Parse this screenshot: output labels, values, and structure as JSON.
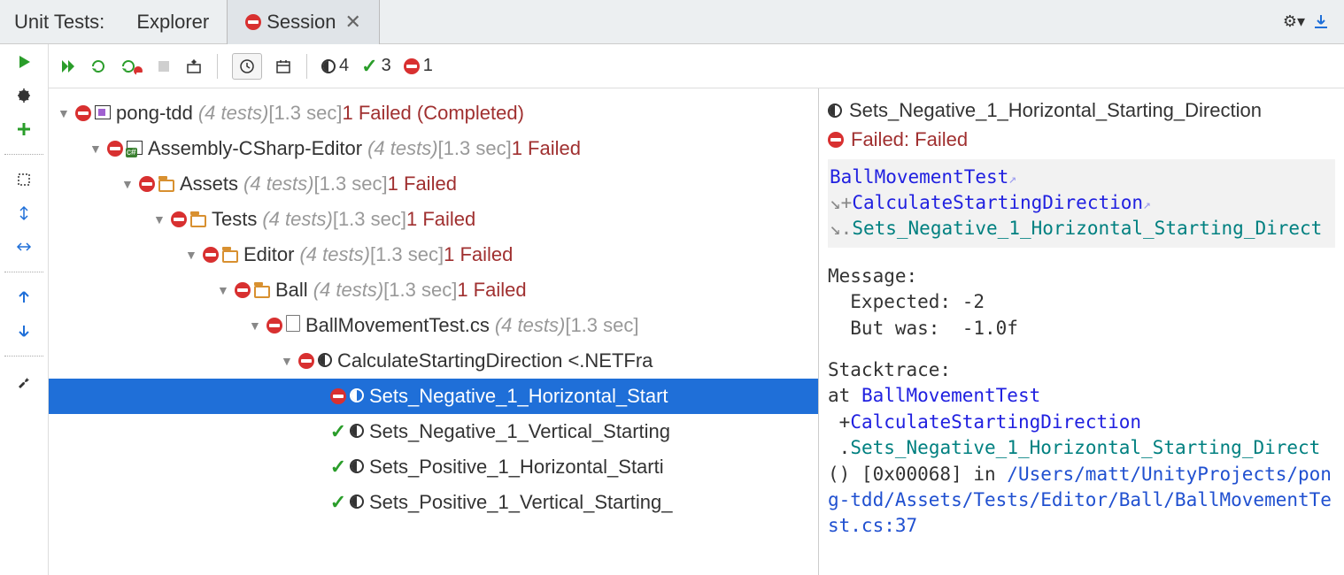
{
  "header": {
    "title": "Unit Tests:",
    "tabs": [
      {
        "label": "Explorer",
        "active": false,
        "closeable": false,
        "status": null
      },
      {
        "label": "Session",
        "active": true,
        "closeable": true,
        "status": "fail"
      }
    ]
  },
  "toolbar": {
    "counts": {
      "half": "4",
      "pass": "3",
      "fail": "1"
    }
  },
  "tree": {
    "rows": [
      {
        "depth": 0,
        "arrow": true,
        "status": "fail",
        "type": "proj",
        "name": "pong-tdd",
        "meta": "(4 tests)",
        "time": "[1.3 sec]",
        "fail": "1 Failed (Completed)"
      },
      {
        "depth": 1,
        "arrow": true,
        "status": "fail",
        "type": "cs",
        "name": "Assembly-CSharp-Editor",
        "meta": "(4 tests)",
        "time": "[1.3 sec]",
        "fail": "1 Failed"
      },
      {
        "depth": 2,
        "arrow": true,
        "status": "fail",
        "type": "folder",
        "name": "Assets",
        "meta": "(4 tests)",
        "time": "[1.3 sec]",
        "fail": "1 Failed"
      },
      {
        "depth": 3,
        "arrow": true,
        "status": "fail",
        "type": "folder",
        "name": "Tests",
        "meta": "(4 tests)",
        "time": "[1.3 sec]",
        "fail": "1 Failed"
      },
      {
        "depth": 4,
        "arrow": true,
        "status": "fail",
        "type": "folder",
        "name": "Editor",
        "meta": "(4 tests)",
        "time": "[1.3 sec]",
        "fail": "1 Failed"
      },
      {
        "depth": 5,
        "arrow": true,
        "status": "fail",
        "type": "folder",
        "name": "Ball",
        "meta": "(4 tests)",
        "time": "[1.3 sec]",
        "fail": "1 Failed"
      },
      {
        "depth": 6,
        "arrow": true,
        "status": "fail",
        "type": "file",
        "name": "BallMovementTest.cs",
        "meta": "(4 tests)",
        "time": "[1.3 sec]",
        "fail": ""
      },
      {
        "depth": 7,
        "arrow": true,
        "status": "fail",
        "type": "half",
        "name": "CalculateStartingDirection <.NETFra",
        "meta": "",
        "time": "",
        "fail": ""
      },
      {
        "depth": 8,
        "arrow": false,
        "status": "fail",
        "type": "half",
        "name": "Sets_Negative_1_Horizontal_Start",
        "meta": "",
        "time": "",
        "fail": "",
        "selected": true
      },
      {
        "depth": 8,
        "arrow": false,
        "status": "pass",
        "type": "half",
        "name": "Sets_Negative_1_Vertical_Starting",
        "meta": "",
        "time": "",
        "fail": ""
      },
      {
        "depth": 8,
        "arrow": false,
        "status": "pass",
        "type": "half",
        "name": "Sets_Positive_1_Horizontal_Starti",
        "meta": "",
        "time": "",
        "fail": ""
      },
      {
        "depth": 8,
        "arrow": false,
        "status": "pass",
        "type": "half",
        "name": "Sets_Positive_1_Vertical_Starting_",
        "meta": "",
        "time": "",
        "fail": ""
      }
    ]
  },
  "detail": {
    "title": "Sets_Negative_1_Horizontal_Starting_Direction",
    "status_label": "Failed: Failed",
    "path": {
      "class": "BallMovementTest",
      "prefix1": "+",
      "method": "CalculateStartingDirection",
      "prefix2": ".",
      "test": "Sets_Negative_1_Horizontal_Starting_Direct"
    },
    "message_label": "Message:",
    "message_body": "  Expected: -2\n  But was:  -1.0f",
    "trace_label": "Stacktrace:",
    "trace": {
      "at": "at ",
      "class": "BallMovementTest",
      "p1": "+",
      "method": "CalculateStartingDirection",
      "p2": ".",
      "test": "Sets_Negative_1_Horizontal_Starting_Direct",
      "suffix": " () [0x00068] in ",
      "path": "/Users/matt/UnityProjects/pong-tdd/Assets/Tests/Editor/Ball/BallMovementTest.cs:37"
    }
  }
}
